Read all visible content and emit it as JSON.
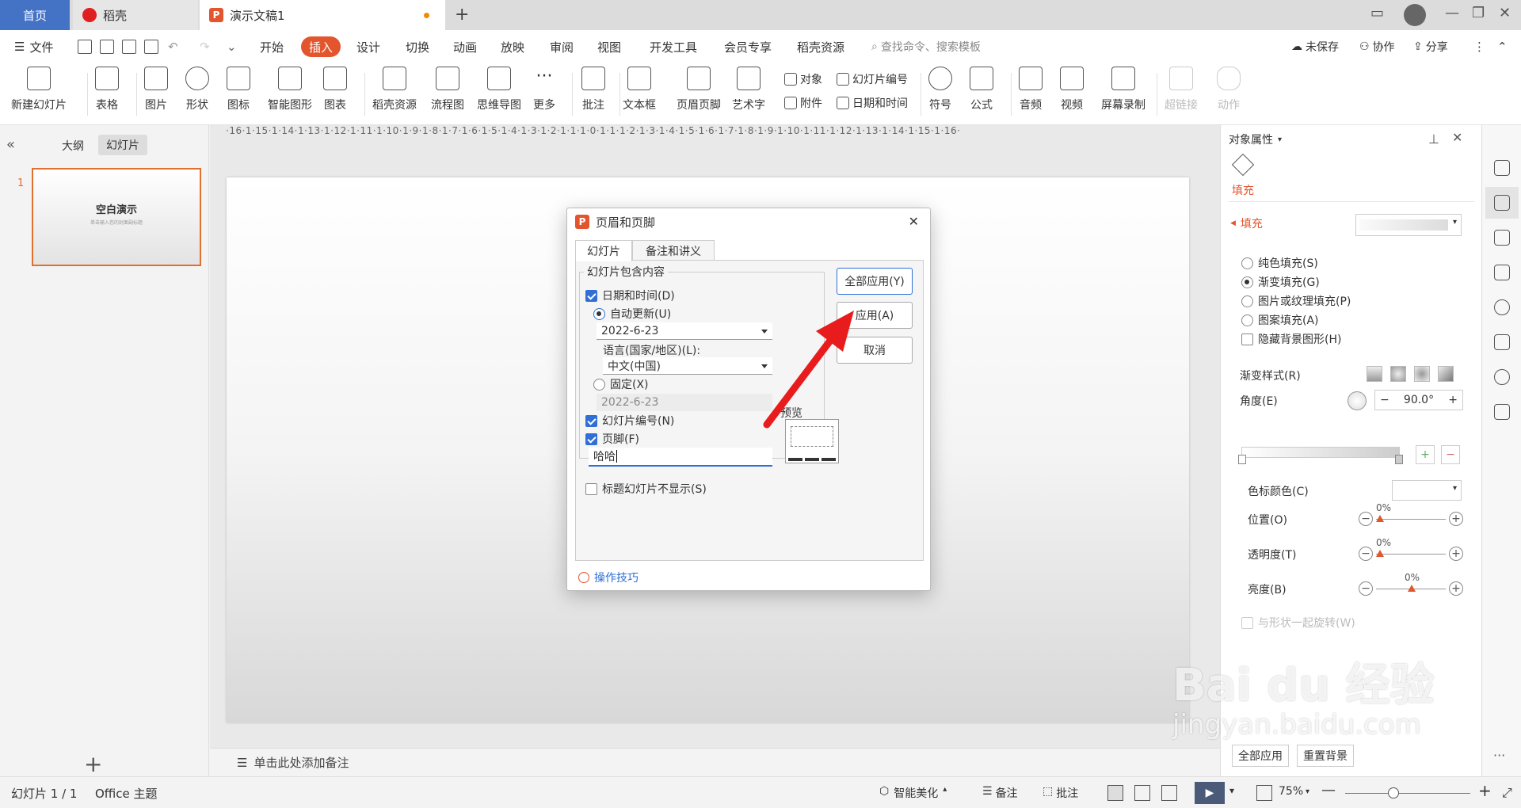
{
  "tabs": {
    "home": "首页",
    "daoke": "稻壳",
    "document": "演示文稿1"
  },
  "menu": {
    "file": "文件",
    "items": [
      "开始",
      "插入",
      "设计",
      "切换",
      "动画",
      "放映",
      "审阅",
      "视图",
      "开发工具",
      "会员专享",
      "稻壳资源"
    ],
    "active": "插入",
    "search_placeholder": "查找命令、搜索模板",
    "unsaved": "未保存",
    "collaborate": "协作",
    "share": "分享"
  },
  "ribbon": {
    "new_slide": "新建幻灯片",
    "table": "表格",
    "picture": "图片",
    "shape": "形状",
    "icon": "图标",
    "smart_graphic": "智能图形",
    "chart": "图表",
    "daoke_resource": "稻壳资源",
    "flowchart": "流程图",
    "mindmap": "思维导图",
    "more": "更多",
    "comment": "批注",
    "textbox": "文本框",
    "header_footer": "页眉页脚",
    "art_text": "艺术字",
    "object": "对象",
    "attachment": "附件",
    "slide_number": "幻灯片编号",
    "datetime": "日期和时间",
    "symbol": "符号",
    "formula": "公式",
    "audio": "音频",
    "video": "视频",
    "screen_record": "屏幕录制",
    "hyperlink": "超链接",
    "action": "动作"
  },
  "ruler": "·16·1·15·1·14·1·13·1·12·1·11·1·10·1·9·1·8·1·7·1·6·1·5·1·4·1·3·1·2·1·1·1·0·1·1·1·2·1·3·1·4·1·5·1·6·1·7·1·8·1·9·1·10·1·11·1·12·1·13·1·14·1·15·1·16·",
  "left_panel": {
    "outline_tab": "大纲",
    "slides_tab": "幻灯片",
    "slide_number": "1",
    "thumb_title": "空白演示",
    "thumb_subtitle": "单击输入您的封面副标题"
  },
  "notes_placeholder": "单击此处添加备注",
  "dialog": {
    "title": "页眉和页脚",
    "tab_slide": "幻灯片",
    "tab_notes": "备注和讲义",
    "group_label": "幻灯片包含内容",
    "datetime_label": "日期和时间(D)",
    "auto_update_label": "自动更新(U)",
    "date_value": "2022-6-23",
    "language_label": "语言(国家/地区)(L):",
    "language_value": "中文(中国)",
    "fixed_label": "固定(X)",
    "fixed_value": "2022-6-23",
    "slide_number_label": "幻灯片编号(N)",
    "footer_label": "页脚(F)",
    "footer_value": "哈哈",
    "title_slide_hide_label": "标题幻灯片不显示(S)",
    "apply_all": "全部应用(Y)",
    "apply": "应用(A)",
    "cancel": "取消",
    "preview_label": "预览",
    "tips": "操作技巧"
  },
  "right_panel": {
    "title": "对象属性",
    "fill_tab": "填充",
    "fill_section": "填充",
    "solid_fill": "纯色填充(S)",
    "gradient_fill": "渐变填充(G)",
    "picture_fill": "图片或纹理填充(P)",
    "pattern_fill": "图案填充(A)",
    "hide_bg": "隐藏背景图形(H)",
    "gradient_style": "渐变样式(R)",
    "angle": "角度(E)",
    "angle_value": "90.0°",
    "color_stop": "色标颜色(C)",
    "position": "位置(O)",
    "position_value": "0%",
    "transparency": "透明度(T)",
    "transparency_value": "0%",
    "brightness": "亮度(B)",
    "brightness_value": "0%",
    "rotate_with_shape": "与形状一起旋转(W)",
    "apply_all": "全部应用",
    "reset_bg": "重置背景"
  },
  "status": {
    "slide_info": "幻灯片 1 / 1",
    "theme": "Office 主题",
    "smart_beautify": "智能美化",
    "notes": "备注",
    "comments": "批注",
    "zoom": "75%"
  },
  "watermark": "Bai du 经验",
  "watermark_url": "jingyan.baidu.com",
  "colors": {
    "accent": "#e2552d",
    "home_tab": "#4472c4",
    "arrow": "#e81c1c",
    "checkbox": "#2f6fd6"
  }
}
